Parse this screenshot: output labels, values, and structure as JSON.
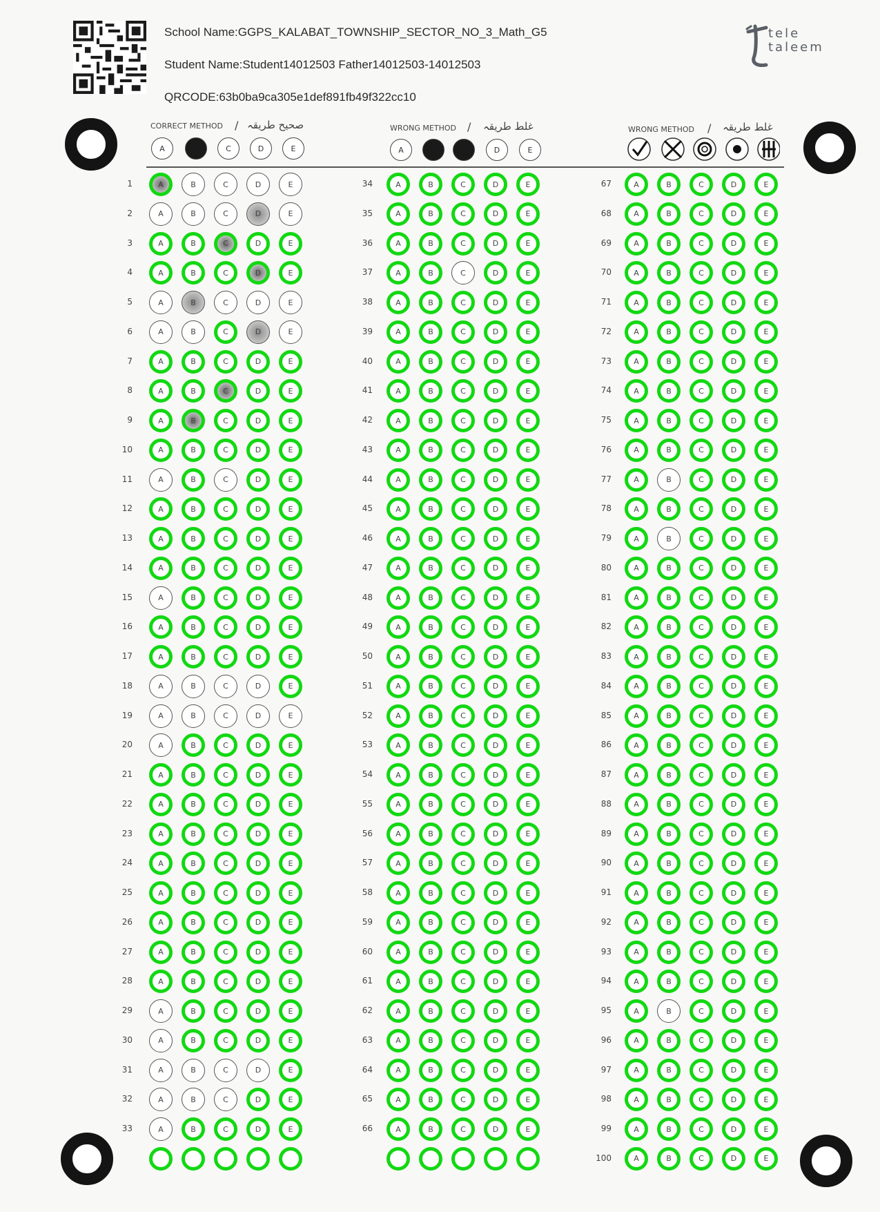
{
  "header": {
    "school_line": "School Name:GGPS_KALABAT_TOWNSHIP_SECTOR_NO_3_Math_G5",
    "student_line": "Student Name:Student14012503 Father14012503-14012503",
    "qrcode_line": "QRCODE:63b0ba9ca305e1def891fb49f322cc10"
  },
  "logo": {
    "line1": "tele",
    "line2": "taleem"
  },
  "legend": [
    {
      "title": "CORRECT METHOD",
      "arabic": "صحیح طریقہ",
      "bubbles": [
        "A",
        "",
        "C",
        "D",
        "E"
      ],
      "filled": [
        1
      ]
    },
    {
      "title": "WRONG METHOD",
      "arabic": "غلط طریقہ",
      "bubbles": [
        "A",
        "",
        "",
        "D",
        "E"
      ],
      "filled": [
        1,
        2
      ]
    },
    {
      "title": "WRONG METHOD",
      "arabic": "غلط طریقہ",
      "symbols": [
        "check",
        "cross",
        "circled-c",
        "dot",
        "lines"
      ]
    }
  ],
  "options": [
    "A",
    "B",
    "C",
    "D",
    "E"
  ],
  "question_count": 100,
  "detection_color": "#12d812",
  "answers_shaded": {
    "1": "A",
    "2": "D",
    "3": "C",
    "4": "D",
    "5": "B",
    "6": "D",
    "8": "C",
    "9": "B"
  },
  "rings_absent": {
    "1": "BCDE",
    "2": "ABCDE",
    "3": "",
    "4": "",
    "5": "ABCDE",
    "6": "ABDE",
    "11": "AC",
    "15": "A",
    "18": "ABCD",
    "19": "ABCDE",
    "20": "A",
    "29": "A",
    "30": "A",
    "31": "ABCD",
    "32": "ABC",
    "33": "A",
    "37": "C",
    "77": "B",
    "79": "B",
    "95": "B"
  },
  "bottom_row_rings": true
}
